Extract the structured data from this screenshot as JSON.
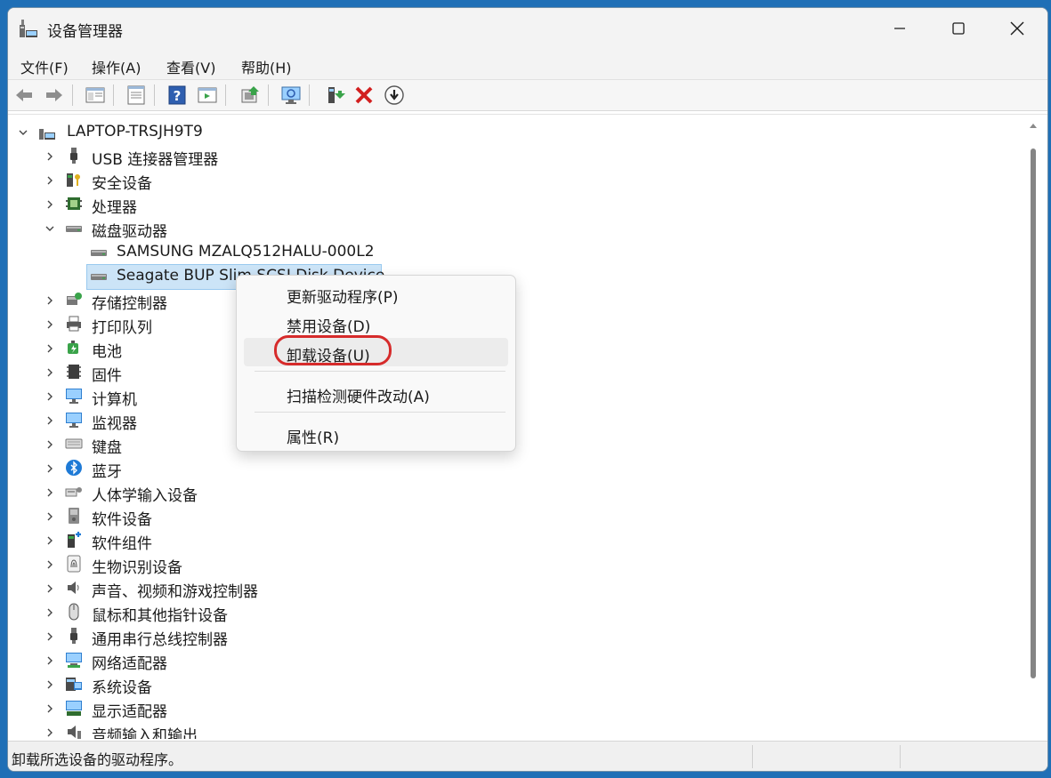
{
  "window": {
    "title": "设备管理器"
  },
  "menubar": {
    "items": [
      {
        "label": "文件(F)"
      },
      {
        "label": "操作(A)"
      },
      {
        "label": "查看(V)"
      },
      {
        "label": "帮助(H)"
      }
    ]
  },
  "toolbar": {
    "buttons": [
      "back-icon",
      "forward-icon",
      "show-hide-tree-icon",
      "properties-icon",
      "help-icon",
      "view-icon",
      "update-driver-icon",
      "scan-hardware-icon",
      "enable-device-icon",
      "uninstall-x-icon",
      "download-icon"
    ]
  },
  "tree": {
    "root": {
      "label": "LAPTOP-TRSJH9T9",
      "icon": "computer-icon",
      "expanded": true
    },
    "nodes": [
      {
        "label": "USB 连接器管理器",
        "icon": "usb-icon",
        "expanded": false
      },
      {
        "label": "安全设备",
        "icon": "security-device-icon",
        "expanded": false
      },
      {
        "label": "处理器",
        "icon": "processor-icon",
        "expanded": false
      },
      {
        "label": "磁盘驱动器",
        "icon": "disk-drive-icon",
        "expanded": true,
        "children": [
          {
            "label": "SAMSUNG MZALQ512HALU-000L2",
            "icon": "disk-icon",
            "selected": false
          },
          {
            "label": "Seagate BUP Slim SCSI Disk Device",
            "icon": "disk-icon",
            "selected": true
          }
        ]
      },
      {
        "label": "存储控制器",
        "icon": "storage-controller-icon",
        "expanded": false
      },
      {
        "label": "打印队列",
        "icon": "printer-icon",
        "expanded": false
      },
      {
        "label": "电池",
        "icon": "battery-icon",
        "expanded": false
      },
      {
        "label": "固件",
        "icon": "firmware-icon",
        "expanded": false
      },
      {
        "label": "计算机",
        "icon": "monitor-icon",
        "expanded": false
      },
      {
        "label": "监视器",
        "icon": "monitor-icon",
        "expanded": false
      },
      {
        "label": "键盘",
        "icon": "keyboard-icon",
        "expanded": false
      },
      {
        "label": "蓝牙",
        "icon": "bluetooth-icon",
        "expanded": false
      },
      {
        "label": "人体学输入设备",
        "icon": "hid-icon",
        "expanded": false
      },
      {
        "label": "软件设备",
        "icon": "software-device-icon",
        "expanded": false
      },
      {
        "label": "软件组件",
        "icon": "software-component-icon",
        "expanded": false
      },
      {
        "label": "生物识别设备",
        "icon": "fingerprint-icon",
        "expanded": false
      },
      {
        "label": "声音、视频和游戏控制器",
        "icon": "speaker-icon",
        "expanded": false
      },
      {
        "label": "鼠标和其他指针设备",
        "icon": "mouse-icon",
        "expanded": false
      },
      {
        "label": "通用串行总线控制器",
        "icon": "usb-icon",
        "expanded": false
      },
      {
        "label": "网络适配器",
        "icon": "network-adapter-icon",
        "expanded": false
      },
      {
        "label": "系统设备",
        "icon": "system-device-icon",
        "expanded": false
      },
      {
        "label": "显示适配器",
        "icon": "display-adapter-icon",
        "expanded": false
      },
      {
        "label": "音频输入和输出",
        "icon": "audio-io-icon",
        "expanded": false
      }
    ]
  },
  "context_menu": {
    "items": [
      {
        "label": "更新驱动程序(P)"
      },
      {
        "label": "禁用设备(D)"
      },
      {
        "label": "卸载设备(U)",
        "highlighted": true
      },
      {
        "label": "扫描检测硬件改动(A)"
      },
      {
        "label": "属性(R)"
      }
    ]
  },
  "statusbar": {
    "text": "卸载所选设备的驱动程序。"
  },
  "colors": {
    "selection_bg": "#cce4f7",
    "selection_border": "#99c9ef",
    "highlight_ring": "#d62b2b",
    "desktop": "#1f6fb6"
  }
}
